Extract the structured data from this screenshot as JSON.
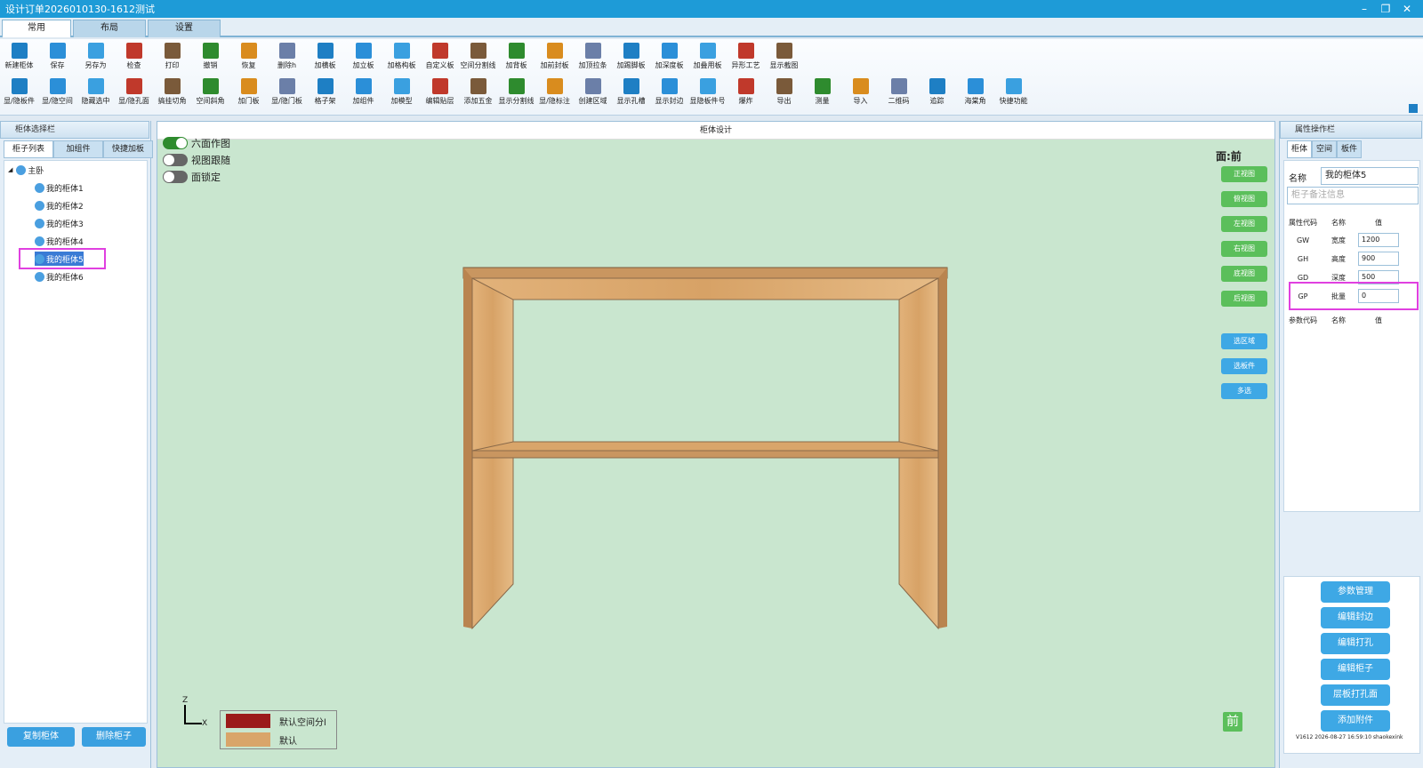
{
  "window": {
    "title": "设计订单2026010130-1612测试",
    "controls": [
      "–",
      "❐",
      "✕"
    ]
  },
  "main_tabs": [
    "常用",
    "布局",
    "设置"
  ],
  "toolbar_row1": [
    "新建柜体",
    "保存",
    "另存为",
    "检查",
    "打印",
    "撤销",
    "恢复",
    "删除h",
    "加横板",
    "加立板",
    "加格构板",
    "自定义板",
    "空间分割线",
    "加背板",
    "加前封板",
    "加顶拉条",
    "加踢脚板",
    "加深度板",
    "加叠用板",
    "异形工艺",
    "显示截图"
  ],
  "toolbar_row2": [
    "显/隐板件",
    "显/隐空间",
    "隐藏选中",
    "显/隐孔面",
    "搞挂切角",
    "空间斜角",
    "加门板",
    "显/隐门板",
    "格子架",
    "加组件",
    "加模型",
    "编辑贴层",
    "添加五金",
    "显示分割线",
    "显/隐标注",
    "创建区域",
    "显示孔槽",
    "显示封边",
    "显隐板件号",
    "爆炸",
    "导出",
    "测量",
    "导入",
    "二维码",
    "追踪",
    "海棠角",
    "快捷功能"
  ],
  "left_panel": {
    "header": "柜体选择栏",
    "tabs": [
      "柜子列表",
      "加组件",
      "快捷加板"
    ],
    "root": "主卧",
    "items": [
      "我的柜体1",
      "我的柜体2",
      "我的柜体3",
      "我的柜体4",
      "我的柜体5",
      "我的柜体6"
    ],
    "selected_index": 4,
    "buttons": [
      "复制柜体",
      "删除柜子"
    ]
  },
  "center": {
    "header": "柜体设计",
    "toggles": [
      {
        "label": "六面作图",
        "on": true
      },
      {
        "label": "视图跟随",
        "on": false
      },
      {
        "label": "面锁定",
        "on": false
      }
    ],
    "face_label": "面:前",
    "view_buttons": [
      "正视图",
      "俯视图",
      "左视图",
      "右视图",
      "底视图",
      "后视图"
    ],
    "select_buttons": [
      "选区域",
      "选板件",
      "多选"
    ],
    "legend": [
      {
        "label": "默认空间分l",
        "color": "#9b1a1a"
      },
      {
        "label": "默认",
        "color": "#d9a56a"
      }
    ],
    "axis": {
      "z": "Z",
      "x": "X"
    },
    "front_badge": "前"
  },
  "right_panel": {
    "header": "属性操作栏",
    "tabs": [
      "柜体",
      "空间",
      "板件"
    ],
    "name_label": "名称",
    "name_value": "我的柜体5",
    "note_placeholder": "柜子备注信息",
    "prop_headers": [
      "属性代码",
      "名称",
      "值"
    ],
    "props": [
      {
        "code": "GW",
        "name": "宽度",
        "value": "1200"
      },
      {
        "code": "GH",
        "name": "高度",
        "value": "900"
      },
      {
        "code": "GD",
        "name": "深度",
        "value": "500"
      },
      {
        "code": "GP",
        "name": "批量",
        "value": "0"
      }
    ],
    "param_headers": [
      "参数代码",
      "名称",
      "值"
    ],
    "buttons": [
      "参数管理",
      "编辑封边",
      "编辑打孔",
      "编辑柜子",
      "层板打孔面",
      "添加附件"
    ],
    "version": "V1612 2026-08-27 16:59:10 shaokexink"
  },
  "colors": {
    "accent": "#1e9bd7",
    "canvas": "#c9e6cf",
    "wood": "#d9a56a",
    "highlight": "#e040e0",
    "green_btn": "#5bbf5b"
  }
}
